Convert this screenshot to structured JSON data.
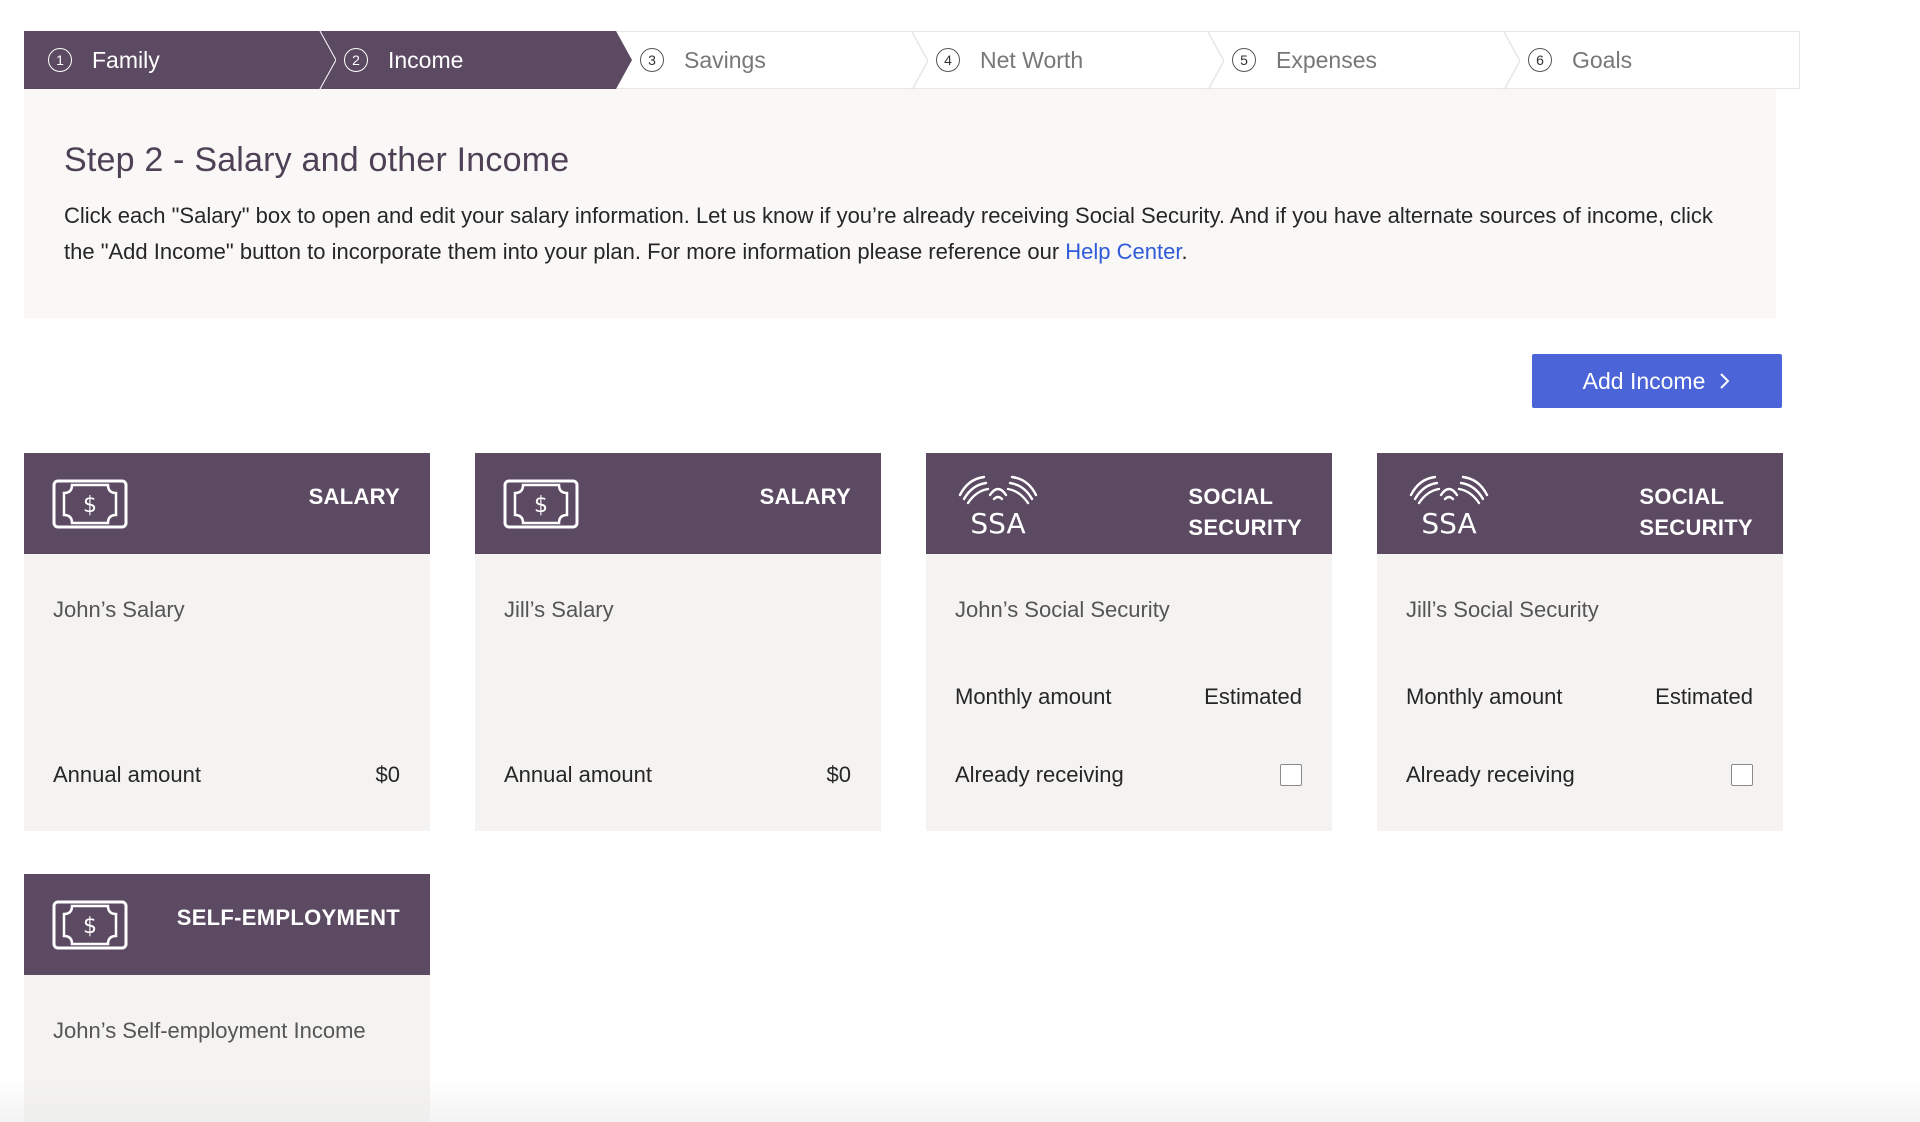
{
  "stepper": {
    "steps": [
      {
        "num": "1",
        "label": "Family"
      },
      {
        "num": "2",
        "label": "Income"
      },
      {
        "num": "3",
        "label": "Savings"
      },
      {
        "num": "4",
        "label": "Net Worth"
      },
      {
        "num": "5",
        "label": "Expenses"
      },
      {
        "num": "6",
        "label": "Goals"
      }
    ],
    "active_step": 2
  },
  "intro": {
    "title": "Step 2 - Salary and other Income",
    "body": "Click each \"Salary\" box to open and edit your salary information. Let us know if you’re already receiving Social Security. And if you have alternate sources of income, click the \"Add Income\" button to incorporate them into your plan. For more information please reference our ",
    "link_text": "Help Center",
    "after_link": "."
  },
  "add_income": {
    "label": "Add Income",
    "icon": "chevron-right-icon"
  },
  "cards": [
    {
      "type": "SALARY",
      "icon": "money-icon",
      "title": "John’s Salary",
      "row_label": "Annual amount",
      "row_value": "$0"
    },
    {
      "type": "SALARY",
      "icon": "money-icon",
      "title": "Jill’s Salary",
      "row_label": "Annual amount",
      "row_value": "$0"
    },
    {
      "type_line1": "SOCIAL",
      "type_line2": "SECURITY",
      "icon": "ssa-logo",
      "logo_text": "SSA",
      "title": "John’s Social Security",
      "monthly_label": "Monthly amount",
      "monthly_value": "Estimated",
      "receiving_label": "Already receiving",
      "receiving_checked": false
    },
    {
      "type_line1": "SOCIAL",
      "type_line2": "SECURITY",
      "icon": "ssa-logo",
      "logo_text": "SSA",
      "title": "Jill’s Social Security",
      "monthly_label": "Monthly amount",
      "monthly_value": "Estimated",
      "receiving_label": "Already receiving",
      "receiving_checked": false
    },
    {
      "type": "SELF-EMPLOYMENT",
      "icon": "money-icon",
      "title": "John’s Self-employment Income"
    }
  ],
  "colors": {
    "header_purple": "#5c4a63",
    "button_blue": "#4b65d9",
    "link_blue": "#2f5bd8",
    "panel_bg": "#f9f8f7",
    "card_bg": "#f4f3f1"
  }
}
